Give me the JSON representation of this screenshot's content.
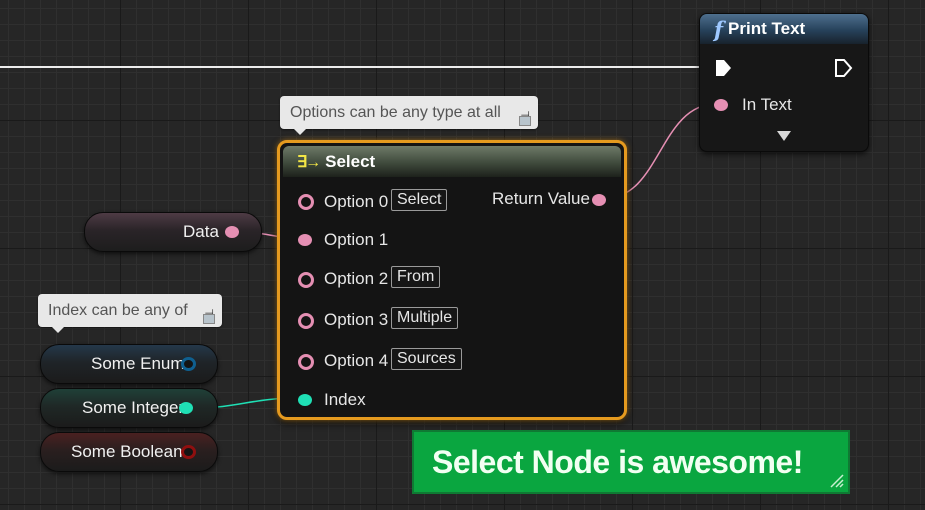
{
  "print_node": {
    "title": "Print Text",
    "in_text_label": "In Text",
    "func_glyph": "f",
    "icons": [
      "function-icon",
      "exec-in-pin-icon",
      "exec-out-pin-icon",
      "expand-arrow-icon"
    ]
  },
  "comments": {
    "options": "Options can be any type at all",
    "index": "Index can be any of"
  },
  "select_node": {
    "title": "Select",
    "icon": "select-icon",
    "options": [
      {
        "label": "Option 0",
        "value": "Select"
      },
      {
        "label": "Option 1",
        "value": ""
      },
      {
        "label": "Option 2",
        "value": "From"
      },
      {
        "label": "Option 3",
        "value": "Multiple"
      },
      {
        "label": "Option 4",
        "value": "Sources"
      }
    ],
    "index_label": "Index",
    "return_label": "Return Value"
  },
  "variables": {
    "data": "Data",
    "enum": "Some Enum",
    "integer": "Some Integer",
    "boolean": "Some Boolean"
  },
  "green_comment": "Select Node is awesome!",
  "colors": {
    "string_pin": "#e58fb3",
    "integer_pin": "#1fe0b5",
    "enum_pin": "#0f5f8f",
    "boolean_pin": "#8f0f0f",
    "exec_wire": "#f0f0f0",
    "select_border": "#e59a1f",
    "comment_green": "#0aa640"
  }
}
